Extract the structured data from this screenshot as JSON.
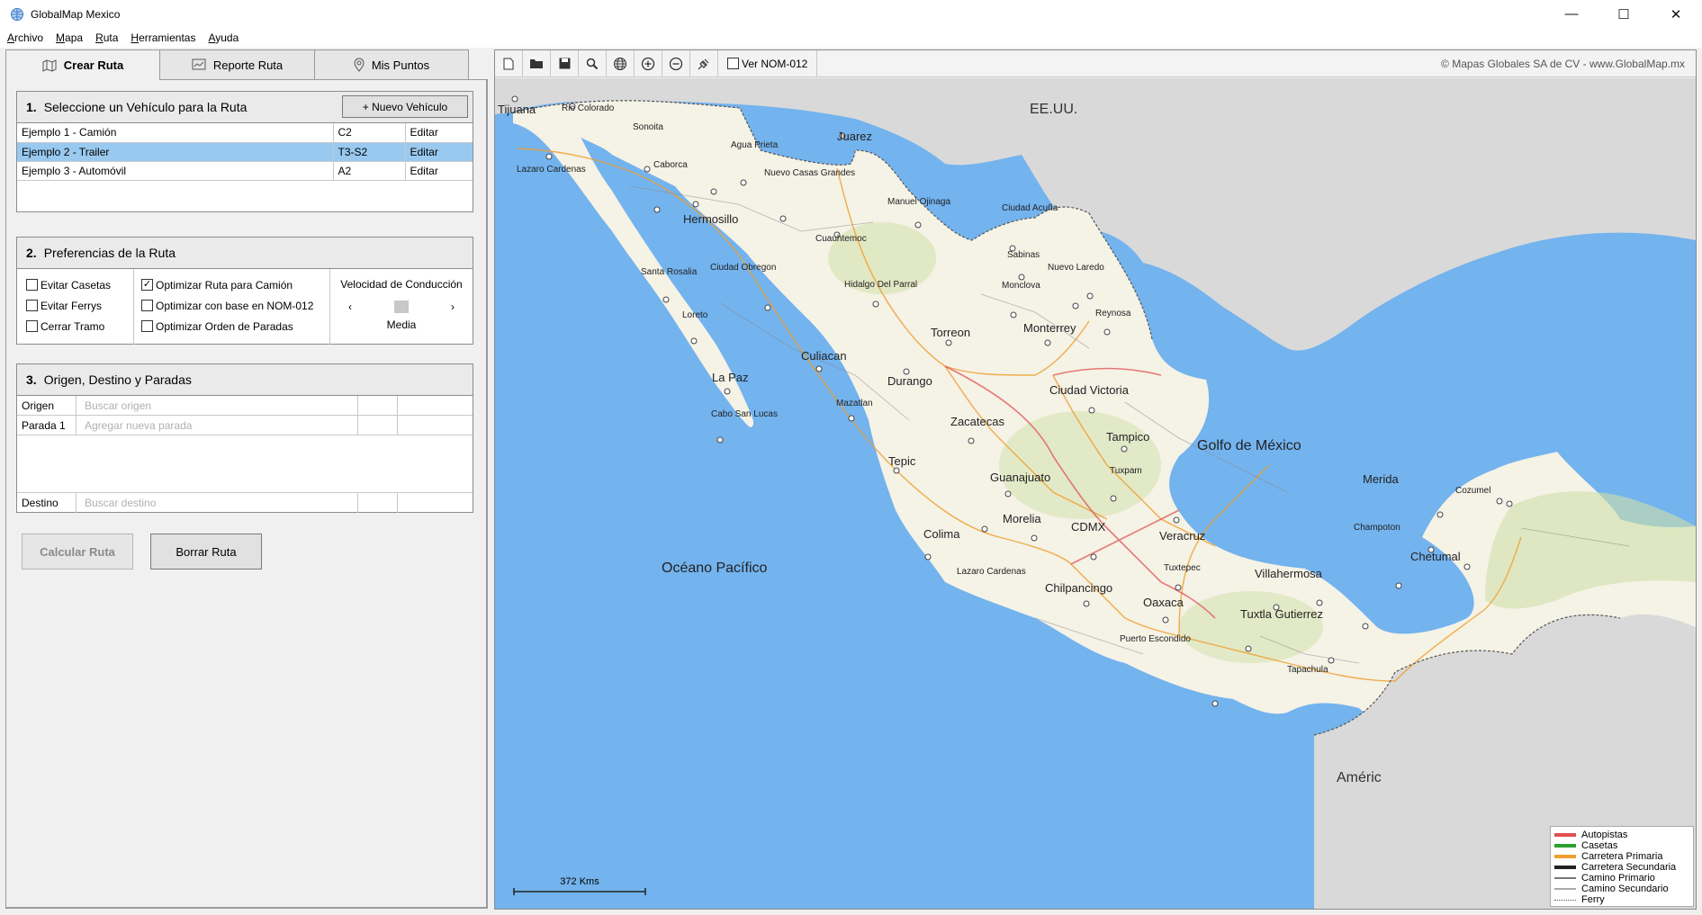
{
  "window": {
    "title": "GlobalMap Mexico"
  },
  "menu": [
    "Archivo",
    "Mapa",
    "Ruta",
    "Herramientas",
    "Ayuda"
  ],
  "tabs": [
    {
      "label": "Crear Ruta",
      "icon": "map-route-icon"
    },
    {
      "label": "Reporte Ruta",
      "icon": "report-chart-icon"
    },
    {
      "label": "Mis Puntos",
      "icon": "location-pin-icon"
    }
  ],
  "section1": {
    "number": "1.",
    "title": "Seleccione un Vehículo para la Ruta",
    "new_vehicle_label": "+ Nuevo Vehículo",
    "vehicles": [
      {
        "name": "Ejemplo 1 - Camión",
        "code": "C2",
        "action": "Editar",
        "selected": false
      },
      {
        "name": "Ejemplo 2 - Trailer",
        "code": "T3-S2",
        "action": "Editar",
        "selected": true
      },
      {
        "name": "Ejemplo 3 - Automóvil",
        "code": "A2",
        "action": "Editar",
        "selected": false
      }
    ]
  },
  "section2": {
    "number": "2.",
    "title": "Preferencias de la Ruta",
    "col1": [
      {
        "label": "Evitar Casetas",
        "checked": false
      },
      {
        "label": "Evitar Ferrys",
        "checked": false
      },
      {
        "label": "Cerrar Tramo",
        "checked": false
      }
    ],
    "col2": [
      {
        "label": "Optimizar Ruta para Camión",
        "checked": true
      },
      {
        "label": "Optimizar con base en NOM-012",
        "checked": false
      },
      {
        "label": "Optimizar Orden de Paradas",
        "checked": false
      }
    ],
    "speed_title": "Velocidad de Conducción",
    "speed_value": "Media"
  },
  "section3": {
    "number": "3.",
    "title": "Origen, Destino y Paradas",
    "origin_label": "Origen",
    "origin_placeholder": "Buscar origen",
    "stop_label": "Parada 1",
    "stop_placeholder": "Agregar nueva parada",
    "dest_label": "Destino",
    "dest_placeholder": "Buscar destino"
  },
  "actions": {
    "calculate": "Calcular Ruta",
    "clear": "Borrar Ruta"
  },
  "toolbar": {
    "icons": [
      "new-document-icon",
      "open-folder-icon",
      "save-icon",
      "search-icon",
      "globe-icon",
      "zoom-in-icon",
      "zoom-out-icon",
      "satellite-icon"
    ],
    "nom_label": "Ver NOM-012",
    "nom_checked": false,
    "copyright": "© Mapas Globales SA de CV - www.GlobalMap.mx"
  },
  "map": {
    "countries": [
      "EE.UU.",
      "Améric"
    ],
    "seas": [
      "Golfo de México",
      "Océano Pacífico"
    ],
    "cities_major": [
      "Tijuana",
      "Juarez",
      "Hermosillo",
      "Torreon",
      "Monterrey",
      "Culiacan",
      "Durango",
      "La Paz",
      "Ciudad Victoria",
      "Zacatecas",
      "Tampico",
      "Tepic",
      "Guanajuato",
      "Merida",
      "Morelia",
      "CDMX",
      "Colima",
      "Veracruz",
      "Chetumal",
      "Villahermosa",
      "Chilpancingo",
      "Oaxaca",
      "Tuxtla Gutierrez"
    ],
    "cities_minor": [
      "Rio Colorado",
      "Sonoita",
      "Agua Prieta",
      "Caborca",
      "Nuevo Casas Grandes",
      "Lazaro Cardenas",
      "Manuel Ojinaga",
      "Ciudad Acuña",
      "Cuauhtemoc",
      "Sabinas",
      "Nuevo Laredo",
      "Santa Rosalia",
      "Ciudad Obregon",
      "Hidalgo Del Parral",
      "Monclova",
      "Reynosa",
      "Loreto",
      "Mazatlan",
      "Cabo San Lucas",
      "Tuxpam",
      "Champoton",
      "Cozumel",
      "Tuxtepec",
      "Lazaro Cardenas",
      "Puerto Escondido",
      "Tapachula"
    ],
    "scale_label": "372 Kms",
    "legend": [
      {
        "label": "Autopistas",
        "color": "#e05050"
      },
      {
        "label": "Casetas",
        "color": "#2ea02e"
      },
      {
        "label": "Carretera Primaria",
        "color": "#f0a030"
      },
      {
        "label": "Carretera Secundaria",
        "color": "#222222"
      },
      {
        "label": "Camino Primario",
        "color": "#777777"
      },
      {
        "label": "Camino Secundario",
        "color": "#aaaaaa"
      },
      {
        "label": "Ferry",
        "color": "#555555"
      }
    ]
  },
  "colors": {
    "selection": "#99c9ef",
    "land": "#f5f2e6",
    "water": "#73b3ee",
    "usa": "#d9d9d9"
  }
}
